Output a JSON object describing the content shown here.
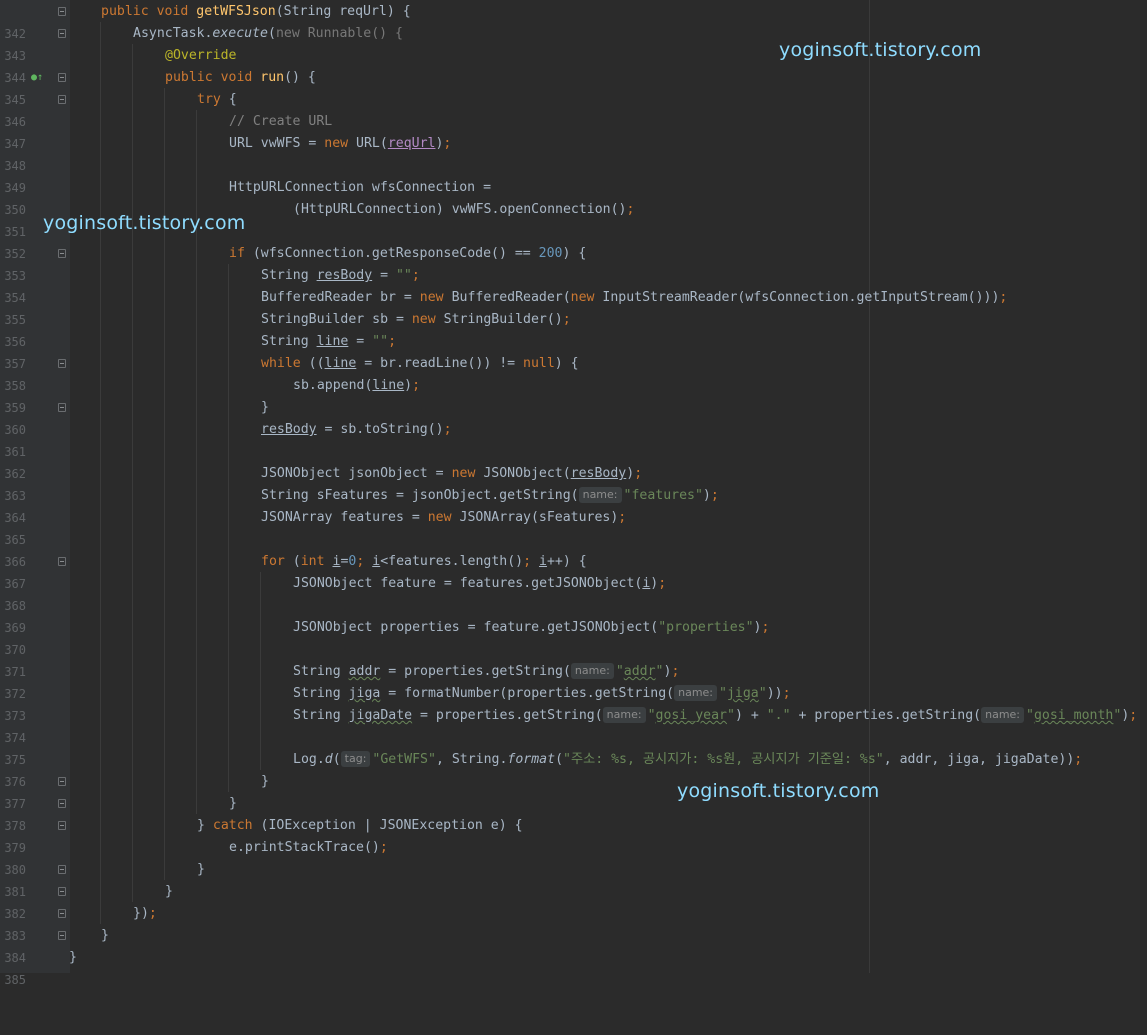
{
  "editor": {
    "line_numbers": [
      "342",
      "343",
      "344",
      "345",
      "346",
      "347",
      "348",
      "349",
      "350",
      "351",
      "352",
      "353",
      "354",
      "355",
      "356",
      "357",
      "358",
      "359",
      "360",
      "361",
      "362",
      "363",
      "364",
      "365",
      "366",
      "367",
      "368",
      "369",
      "370",
      "371",
      "372",
      "373",
      "374",
      "375",
      "376",
      "377",
      "378",
      "379",
      "380",
      "381",
      "382",
      "383",
      "384",
      "385"
    ],
    "code": {
      "l342": {
        "kw1": "public void ",
        "fn": "getWFSJson",
        "rest": "(String reqUrl) {"
      },
      "l343": {
        "a": "AsyncTask.",
        "b": "execute",
        "c": "(",
        "d": "new ",
        "e": "Runnable() {"
      },
      "l344": {
        "an": "@Override"
      },
      "l345": {
        "kw": "public void ",
        "fn": "run",
        "rest": "() {"
      },
      "l346": {
        "kw": "try ",
        "rest": "{"
      },
      "l347": {
        "cm": "// Create URL"
      },
      "l348": {
        "a": "URL vwWFS = ",
        "kw": "new ",
        "b": "URL(",
        "par": "reqUrl",
        "c": ")",
        "semi": ";"
      },
      "l350": {
        "a": "HttpURLConnection wfsConnection ="
      },
      "l351": {
        "a": "(HttpURLConnection) vwWFS.openConnection()",
        "semi": ";"
      },
      "l353": {
        "kw": "if ",
        "a": "(wfsConnection.getResponseCode() == ",
        "num": "200",
        "b": ") {"
      },
      "l354": {
        "a": "String ",
        "v": "resBody",
        "b": " = ",
        "s": "\"\"",
        "semi": ";"
      },
      "l355": {
        "a": "BufferedReader br = ",
        "kw1": "new ",
        "b": "BufferedReader(",
        "kw2": "new ",
        "c": "InputStreamReader(wfsConnection.getInputStream()))",
        "semi": ";"
      },
      "l356": {
        "a": "StringBuilder sb = ",
        "kw": "new ",
        "b": "StringBuilder()",
        "semi": ";"
      },
      "l357": {
        "a": "String ",
        "v": "line",
        "b": " = ",
        "s": "\"\"",
        "semi": ";"
      },
      "l358": {
        "kw": "while ",
        "a": "((",
        "v": "line",
        "b": " = br.readLine()) != ",
        "kw2": "null",
        "c": ") {"
      },
      "l359": {
        "a": "sb.append(",
        "v": "line",
        "b": ")",
        "semi": ";"
      },
      "l360": {
        "a": "}"
      },
      "l361": {
        "v": "resBody",
        "a": " = sb.toString()",
        "semi": ";"
      },
      "l363": {
        "a": "JSONObject jsonObject = ",
        "kw": "new ",
        "b": "JSONObject(",
        "v": "resBody",
        "c": ")",
        "semi": ";"
      },
      "l364": {
        "a": "String sFeatures = jsonObject.getString(",
        "hint": "name:",
        "s": "\"features\"",
        "b": ")",
        "semi": ";"
      },
      "l365": {
        "a": "JSONArray features = ",
        "kw": "new ",
        "b": "JSONArray(sFeatures)",
        "semi": ";"
      },
      "l367": {
        "kw": "for ",
        "a": "(",
        "kw2": "int ",
        "v1": "i",
        "b": "=",
        "num": "0",
        "semi1": "; ",
        "v2": "i",
        "c": "<features.length()",
        "semi2": "; ",
        "v3": "i",
        "d": "++) {"
      },
      "l368": {
        "a": "JSONObject feature = features.getJSONObject(",
        "v": "i",
        "b": ")",
        "semi": ";"
      },
      "l370": {
        "a": "JSONObject properties = feature.getJSONObject(",
        "s": "\"properties\"",
        "b": ")",
        "semi": ";"
      },
      "l372": {
        "a": "String ",
        "v": "addr",
        "b": " = properties.getString(",
        "hint": "name:",
        "s1": "\"",
        "s2": "addr",
        "s3": "\"",
        "c": ")",
        "semi": ";"
      },
      "l373": {
        "a": "String ",
        "v": "jiga",
        "b": " = formatNumber(properties.getString(",
        "hint": "name:",
        "s1": "\"",
        "s2": "jiga",
        "s3": "\"",
        "c": "))",
        "semi": ";"
      },
      "l374": {
        "a": "String ",
        "v": "jigaDate",
        "b": " = properties.getString(",
        "hint1": "name:",
        "s1": "\"",
        "s2": "gosi_year",
        "s3": "\"",
        "c": ") + ",
        "s4": "\".\"",
        "d": " + properties.getString(",
        "hint2": "name:",
        "s5": "\"",
        "s6": "gosi_month",
        "s7": "\"",
        "e": ")",
        "semi": ";"
      },
      "l376": {
        "a": "Log.",
        "it": "d",
        "b": "(",
        "hint": "tag:",
        "s1": "\"GetWFS\"",
        "c": ", String.",
        "it2": "format",
        "d": "(",
        "s2": "\"주소: %s, 공시지가: %s원, 공시지가 기준일: %s\"",
        "e": ", addr, jiga, jigaDate))",
        "semi": ";"
      },
      "l377": {
        "a": "}"
      },
      "l378": {
        "a": "}"
      },
      "l379": {
        "a": "} ",
        "kw": "catch ",
        "b": "(IOException | JSONException e) {"
      },
      "l380": {
        "a": "e.printStackTrace()",
        "semi": ";"
      },
      "l381": {
        "a": "}"
      },
      "l382": {
        "a": "}"
      },
      "l383": {
        "a": "})",
        "semi": ";"
      },
      "l384": {
        "a": "}"
      },
      "l385": {
        "a": "}"
      }
    }
  },
  "watermarks": [
    "yoginsoft.tistory.com",
    "yoginsoft.tistory.com",
    "yoginsoft.tistory.com"
  ],
  "colors": {
    "background": "#2b2b2b",
    "gutter": "#313335",
    "keyword": "#cc7832",
    "method": "#ffc66d",
    "string": "#6a8759",
    "number": "#6897bb",
    "comment": "#808080",
    "annotation": "#bbb529",
    "watermark": "#8fdcff"
  },
  "icons": [
    "fold-icon",
    "override-marker-icon"
  ]
}
